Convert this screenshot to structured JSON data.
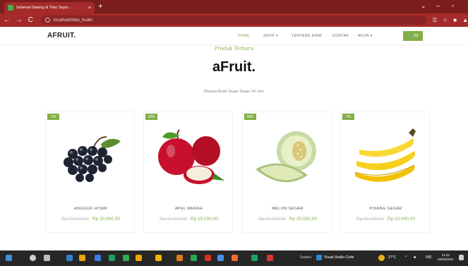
{
  "browser": {
    "tab_title": "Selamat Datang di Toko Sayur ...",
    "tab_close": "×",
    "new_tab": "+",
    "url": "localhost/toko_buah/",
    "back": "←",
    "forward": "→",
    "reload": "C",
    "window_min": "⌄",
    "window_dash": "–",
    "window_close": "▫"
  },
  "site": {
    "brand": "AFRUIT.",
    "menu": [
      "HOME",
      "SHOP ▾",
      "TENTANG KAMI",
      "KONTAK",
      "AKUN ▾"
    ],
    "cart": "[0]",
    "cart_icon": "cart-icon",
    "accent": "#82ae46"
  },
  "hero": {
    "subtitle": "Produk Terbaru",
    "title": "aFruit.",
    "tagline": "Belanja Buah Segar Segar 24 Jam"
  },
  "products": [
    {
      "name": "ANGGUR HITAM",
      "discount": "7%",
      "old_price": "Rp 70.000,00",
      "new_price": "Rp 20.000,00",
      "image": "grapes"
    },
    {
      "name": "APEL MERAH",
      "discount": "18%",
      "old_price": "Rp 33.000,00",
      "new_price": "Rp 15.000,00",
      "image": "apples"
    },
    {
      "name": "MELON SEGAR",
      "discount": "58%",
      "old_price": "Rp 60.000,00",
      "new_price": "Rp 25.000,00",
      "image": "melon"
    },
    {
      "name": "PISANG SEGAR",
      "discount": "7%",
      "old_price": "Rp 35.000,00",
      "new_price": "Rp 10.000,00",
      "image": "bananas"
    }
  ],
  "taskbar": {
    "search_text": "Sodaru",
    "vscode_label": "Visual Studio Code",
    "weather": "27°C",
    "lang": "IND",
    "time": "11.22",
    "date": "25/05/2021"
  }
}
